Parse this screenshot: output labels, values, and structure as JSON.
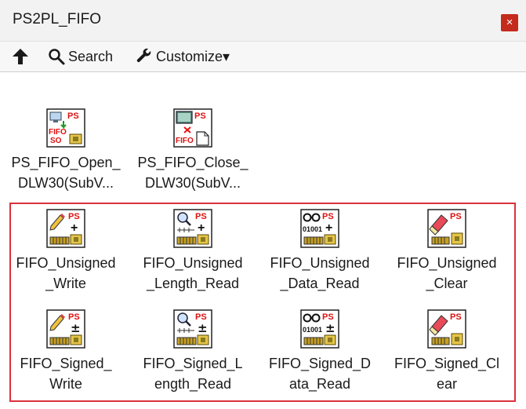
{
  "window": {
    "title": "PS2PL_FIFO",
    "close_glyph": "×"
  },
  "toolbar": {
    "up_icon": "up-arrow-icon",
    "search_label": "Search",
    "customize_label": "Customize▾"
  },
  "palette": {
    "items": [
      {
        "label": "PS_FIFO_Open_\nDLW30(SubV...",
        "icon": "fifo-open-icon"
      },
      {
        "label": "PS_FIFO_Close_\nDLW30(SubV...",
        "icon": "fifo-close-icon"
      },
      {
        "label": "FIFO_Unsigned\n_Write",
        "icon": "unsigned-write-icon"
      },
      {
        "label": "FIFO_Unsigned\n_Length_Read",
        "icon": "unsigned-length-read-icon"
      },
      {
        "label": "FIFO_Unsigned\n_Data_Read",
        "icon": "unsigned-data-read-icon"
      },
      {
        "label": "FIFO_Unsigned\n_Clear",
        "icon": "unsigned-clear-icon"
      },
      {
        "label": "FIFO_Signed_\nWrite",
        "icon": "signed-write-icon"
      },
      {
        "label": "FIFO_Signed_L\nength_Read",
        "icon": "signed-length-read-icon"
      },
      {
        "label": "FIFO_Signed_D\nata_Read",
        "icon": "signed-data-read-icon"
      },
      {
        "label": "FIFO_Signed_Cl\near",
        "icon": "signed-clear-icon"
      }
    ],
    "icon_text": {
      "ps": "PS",
      "fifo": "FIFO",
      "so": "SO",
      "bits": "01001",
      "plus": "+",
      "plusminus": "±"
    }
  },
  "colors": {
    "selection_border": "#d9323b",
    "close_button": "#c42b1c"
  }
}
